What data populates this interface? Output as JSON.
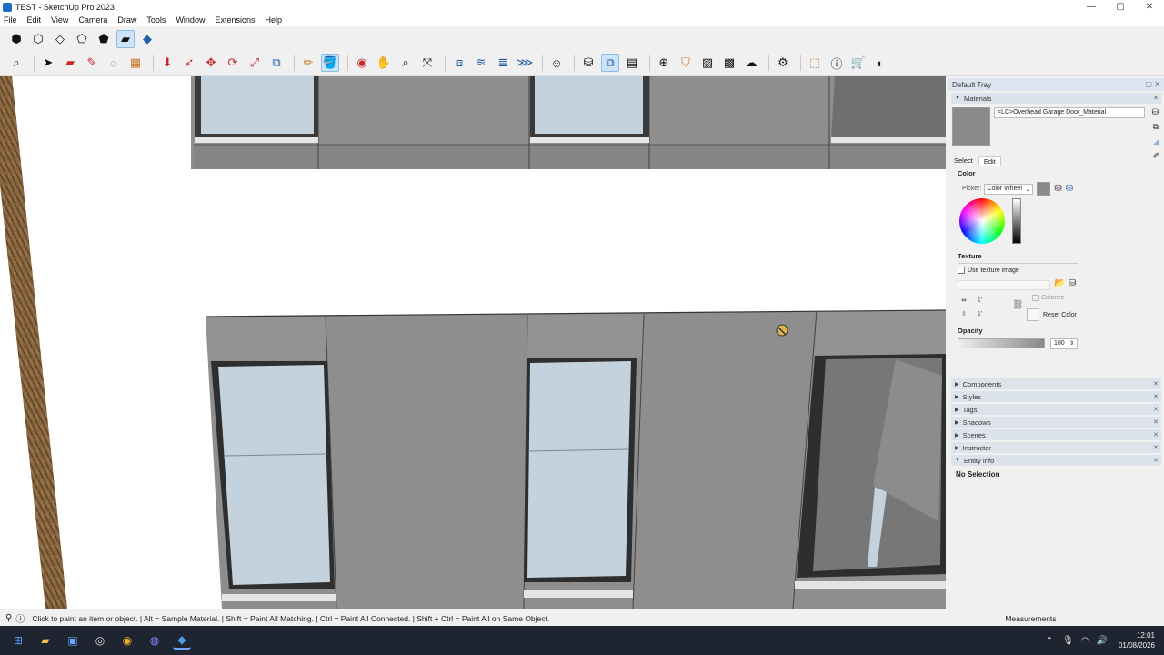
{
  "window": {
    "title": "TEST - SketchUp Pro 2023",
    "controls": [
      "—",
      "▢",
      "✕"
    ]
  },
  "menu": [
    "File",
    "Edit",
    "View",
    "Camera",
    "Draw",
    "Tools",
    "Window",
    "Extensions",
    "Help"
  ],
  "tray": {
    "title": "Default Tray",
    "materials": {
      "header": "Materials",
      "material_name": "<LC>Overhead Garage Door_Material",
      "tabs": [
        "Select",
        "Edit"
      ],
      "color_label": "Color",
      "picker_label": "Picker:",
      "picker_value": "Color Wheel",
      "texture_label": "Texture",
      "use_texture_label": "Use texture image",
      "dim_w": "1'",
      "dim_h": "1'",
      "colorize_label": "Colorize",
      "reset_color_label": "Reset Color",
      "opacity_label": "Opacity",
      "opacity_value": "100",
      "swatch_color": "#8a8a8a"
    },
    "sections": [
      "Components",
      "Styles",
      "Tags",
      "Shadows",
      "Scenes",
      "Instructor",
      "Entity Info"
    ],
    "entity_info_text": "No Selection"
  },
  "status": {
    "hint": "Click to paint an item or object. | Alt = Sample Material. | Shift = Paint All Matching. | Ctrl = Paint All Connected. | Shift + Ctrl = Paint All on Same Object.",
    "measurements_label": "Measurements"
  },
  "taskbar": {
    "time": "12:01",
    "date": "01/08/2026"
  }
}
